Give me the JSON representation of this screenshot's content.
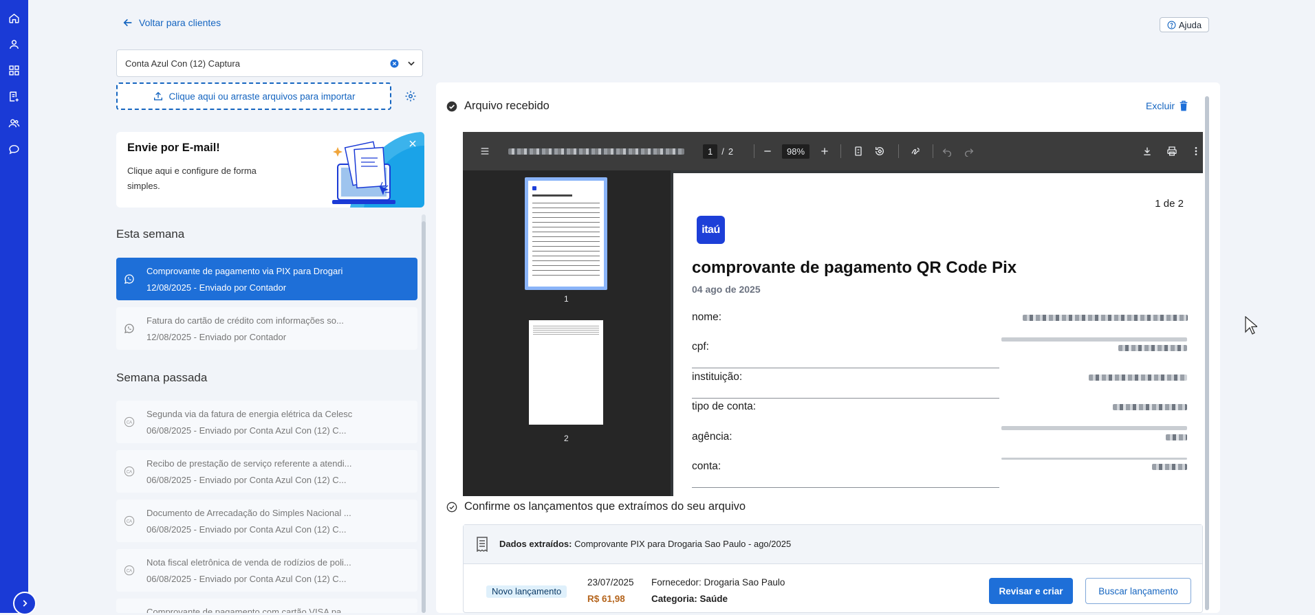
{
  "nav": {
    "back_label": "Voltar para clientes",
    "help_label": "Ajuda"
  },
  "client_select": {
    "value": "Conta Azul Con (12) Captura"
  },
  "import": {
    "label": "Clique aqui ou arraste arquivos para importar"
  },
  "email_card": {
    "title": "Envie por E-mail!",
    "text": "Clique aqui e configure de forma simples."
  },
  "groups": [
    {
      "title": "Esta semana",
      "items": [
        {
          "title": "Comprovante de pagamento via PIX para Drogari",
          "meta": "12/08/2025 - Enviado por Contador",
          "icon": "whatsapp-icon"
        },
        {
          "title": "Fatura do cartão de crédito com informações so...",
          "meta": "12/08/2025 - Enviado por Contador",
          "icon": "whatsapp-icon"
        }
      ]
    },
    {
      "title": "Semana passada",
      "items": [
        {
          "title": "Segunda via da fatura de energia elétrica da Celesc",
          "meta": "06/08/2025 - Enviado por Conta Azul Con (12) C...",
          "icon": "ca-icon"
        },
        {
          "title": "Recibo de prestação de serviço referente a atendi...",
          "meta": "06/08/2025 - Enviado por Conta Azul Con (12) C...",
          "icon": "ca-icon"
        },
        {
          "title": "Documento de Arrecadação do Simples Nacional ...",
          "meta": "06/08/2025 - Enviado por Conta Azul Con (12) C...",
          "icon": "ca-icon"
        },
        {
          "title": "Nota fiscal eletrônica de venda de rodízios de poli...",
          "meta": "06/08/2025 - Enviado por Conta Azul Con (12) C...",
          "icon": "ca-icon"
        },
        {
          "title": "Comprovante de pagamento com cartão VISA pa...",
          "meta": "",
          "icon": "ca-icon"
        }
      ]
    }
  ],
  "file": {
    "status": "Arquivo recebido",
    "delete_label": "Excluir"
  },
  "pdf": {
    "page_current": "1",
    "page_sep": "/",
    "page_total": "2",
    "zoom": "98%",
    "thumb_labels": [
      "1",
      "2"
    ],
    "page_counter": "1 de 2",
    "logo_text": "itaú",
    "doc_title": "comprovante de pagamento QR Code Pix",
    "doc_date": "04 ago de 2025",
    "fields": [
      "nome:",
      "cpf:",
      "instituição:",
      "tipo de conta:",
      "agência:",
      "conta:"
    ]
  },
  "confirm": {
    "title": "Confirme os lançamentos que extraímos do seu arquivo",
    "extracted_label": "Dados extraídos:",
    "extracted_value": "Comprovante PIX para Drogaria Sao Paulo - ago/2025",
    "badge": "Novo lançamento",
    "date": "23/07/2025",
    "amount": "R$ 61,98",
    "supplier": "Fornecedor: Drogaria Sao Paulo",
    "category_label": "Categoria:",
    "category_value": "Saúde",
    "review_button": "Revisar e criar",
    "search_button": "Buscar lançamento"
  },
  "colors": {
    "rail": "#1a3ad6",
    "accent": "#1e6fd8",
    "link": "#1565c0",
    "amount": "#b5651d",
    "itau": "#1d3fd8"
  }
}
